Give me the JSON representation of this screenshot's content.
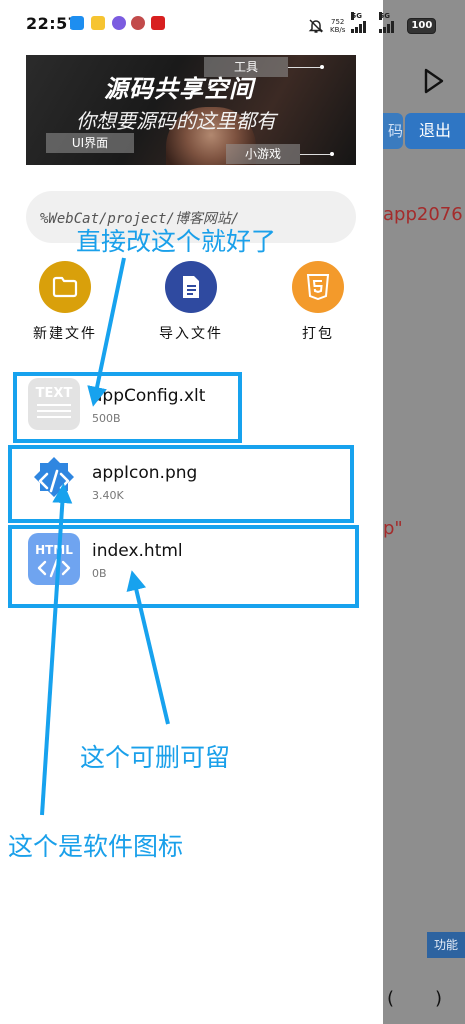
{
  "status_bar": {
    "time": "22:57",
    "net_speed_value": "752",
    "net_speed_unit": "KB/s",
    "signal1_label": "5G",
    "signal2_label": "5G",
    "battery": "100"
  },
  "banner": {
    "title": "源码共享空间",
    "subtitle": "你想要源码的这里都有",
    "tag_tools": "工具",
    "tag_ui": "UI界面",
    "tag_games": "小游戏"
  },
  "path": "%WebCat/project/博客网站/",
  "actions": [
    {
      "label": "新建文件",
      "icon": "folder-icon",
      "color": "#d9a00b"
    },
    {
      "label": "导入文件",
      "icon": "document-icon",
      "color": "#2f4aa0"
    },
    {
      "label": "打包",
      "icon": "html5-icon",
      "color": "#f39a2b"
    }
  ],
  "files": [
    {
      "name": "appConfig.xlt",
      "size": "500B",
      "icon": "text-file-icon",
      "icon_text": "TEXT"
    },
    {
      "name": "appIcon.png",
      "size": "3.40K",
      "icon": "code-badge-icon"
    },
    {
      "name": "index.html",
      "size": "0B",
      "icon": "html-file-icon",
      "icon_text": "HTML"
    }
  ],
  "annotations": {
    "edit_this": "直接改这个就好了",
    "deletable": "这个可删可留",
    "app_icon": "这个是软件图标"
  },
  "editor": {
    "button_partial": "码",
    "exit_label": "退出",
    "code_line1": "app2076",
    "code_line2": "p\"",
    "function_label": "功能",
    "paren_open": "(",
    "paren_close": ")"
  },
  "colors": {
    "annotation_blue": "#17a2ee",
    "overlay_gray": "#8e8e8e",
    "exit_button": "#2f76c4"
  }
}
